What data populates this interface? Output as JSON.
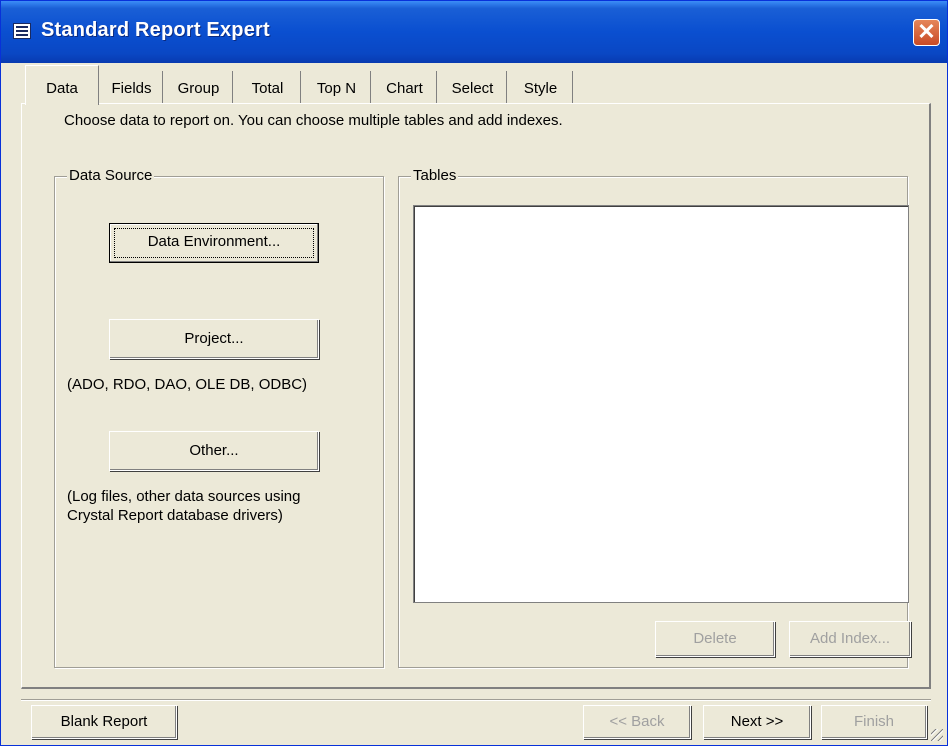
{
  "window": {
    "title": "Standard Report Expert",
    "close_glyph": "✕"
  },
  "tabs": [
    {
      "label": "Data",
      "active": true
    },
    {
      "label": "Fields"
    },
    {
      "label": "Group"
    },
    {
      "label": "Total"
    },
    {
      "label": "Top N"
    },
    {
      "label": "Chart"
    },
    {
      "label": "Select"
    },
    {
      "label": "Style"
    }
  ],
  "data_tab": {
    "instruction": "Choose data to report on. You can choose multiple tables and add indexes.",
    "data_source": {
      "label": "Data Source",
      "data_environment_button": "Data Environment...",
      "project_button": "Project...",
      "project_note": "(ADO, RDO, DAO, OLE DB, ODBC)",
      "other_button": "Other...",
      "other_note_line1": "(Log files, other data sources using",
      "other_note_line2": "Crystal Report database drivers)"
    },
    "tables": {
      "label": "Tables",
      "delete_button": "Delete",
      "add_index_button": "Add Index..."
    }
  },
  "footer": {
    "blank_report_button": "Blank Report",
    "back_button": "<< Back",
    "next_button": "Next >>",
    "finish_button": "Finish"
  }
}
